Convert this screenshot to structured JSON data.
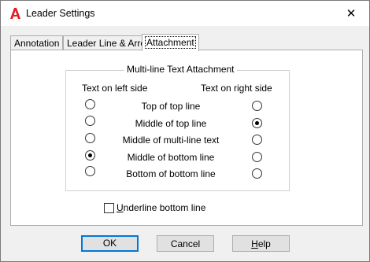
{
  "window": {
    "title": "Leader Settings",
    "close_glyph": "✕",
    "icon": "autocad-app-icon"
  },
  "tabs": [
    {
      "label": "Annotation",
      "active": false
    },
    {
      "label": "Leader Line & Arrow",
      "active": false
    },
    {
      "label": "Attachment",
      "active": true
    }
  ],
  "group": {
    "title": "Multi-line Text Attachment",
    "left_header": "Text on left side",
    "right_header": "Text on right side",
    "rows": [
      {
        "label": "Top of top line",
        "left_checked": false,
        "right_checked": false
      },
      {
        "label": "Middle of top line",
        "left_checked": false,
        "right_checked": true
      },
      {
        "label": "Middle of multi-line text",
        "left_checked": false,
        "right_checked": false
      },
      {
        "label": "Middle of bottom line",
        "left_checked": true,
        "right_checked": false
      },
      {
        "label": "Bottom of bottom line",
        "left_checked": false,
        "right_checked": false
      }
    ]
  },
  "underline": {
    "label_mnemonic": "U",
    "label_rest": "nderline bottom line",
    "checked": false
  },
  "buttons": {
    "ok": "OK",
    "cancel": "Cancel",
    "help_mnemonic": "H",
    "help_rest": "elp"
  },
  "colors": {
    "accent": "#0078d7",
    "icon_red": "#e51a24"
  }
}
